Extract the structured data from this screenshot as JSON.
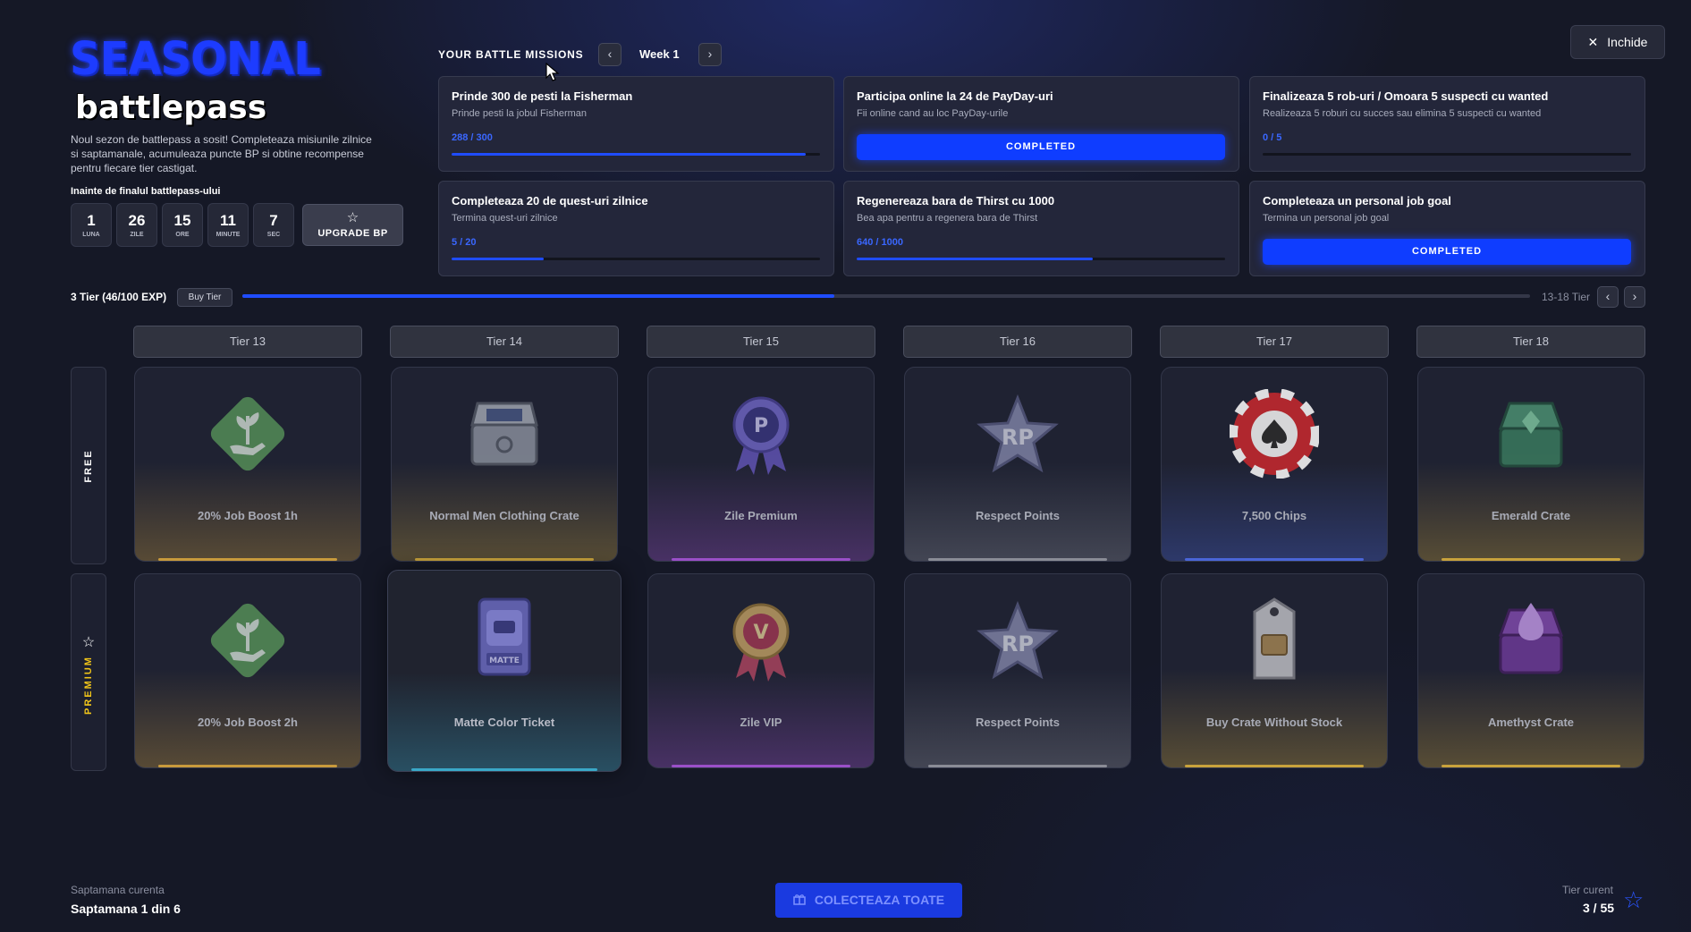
{
  "logo": {
    "seasonal": "SEASONAL",
    "battlepass": "battlepass"
  },
  "intro_text": "Noul sezon de battlepass a sosit! Completeaza misiunile zilnice si saptamanale, acumuleaza puncte BP si obtine recompense pentru fiecare tier castigat.",
  "countdown": {
    "title": "Inainte de finalul battlepass-ului",
    "units": [
      {
        "value": "1",
        "label": "LUNA"
      },
      {
        "value": "26",
        "label": "ZILE"
      },
      {
        "value": "15",
        "label": "ORE"
      },
      {
        "value": "11",
        "label": "MINUTE"
      },
      {
        "value": "7",
        "label": "SEC"
      }
    ]
  },
  "upgrade_button": {
    "label": "UPGRADE BP",
    "icon": "star-outline-icon"
  },
  "missions": {
    "title": "YOUR BATTLE MISSIONS",
    "prev_icon": "‹",
    "next_icon": "›",
    "week": "Week 1",
    "items": [
      {
        "title": "Prinde 300 de pesti la Fisherman",
        "desc": "Prinde pesti la jobul Fisherman",
        "progress_text": "288 / 300",
        "progress": 0.96,
        "completed": false
      },
      {
        "title": "Participa online la 24 de PayDay-uri",
        "desc": "Fii online cand au loc PayDay-urile",
        "progress_text": "",
        "progress": 1,
        "completed": true,
        "completed_label": "COMPLETED"
      },
      {
        "title": "Finalizeaza 5 rob-uri / Omoara 5 suspecti cu wanted",
        "desc": "Realizeaza 5 roburi cu succes sau elimina 5 suspecti cu wanted",
        "progress_text": "0 / 5",
        "progress": 0,
        "completed": false
      },
      {
        "title": "Completeaza 20 de quest-uri zilnice",
        "desc": "Termina quest-uri zilnice",
        "progress_text": "5 / 20",
        "progress": 0.25,
        "completed": false
      },
      {
        "title": "Regenereaza bara de Thirst cu 1000",
        "desc": "Bea apa pentru a regenera bara de Thirst",
        "progress_text": "640 / 1000",
        "progress": 0.64,
        "completed": false
      },
      {
        "title": "Completeaza un personal job goal",
        "desc": "Termina un personal job goal",
        "progress_text": "",
        "progress": 1,
        "completed": true,
        "completed_label": "COMPLETED"
      }
    ]
  },
  "close_button": {
    "label": "Inchide",
    "icon": "✕"
  },
  "tier_progress": {
    "status": "3 Tier (46/100 EXP)",
    "buy_label": "Buy Tier",
    "progress": 0.46,
    "range": "13-18 Tier",
    "prev_icon": "‹",
    "next_icon": "›"
  },
  "tiers": [
    "Tier 13",
    "Tier 14",
    "Tier 15",
    "Tier 16",
    "Tier 17",
    "Tier 18"
  ],
  "rows": {
    "free_label": "FREE",
    "premium_label": "PREMIUM",
    "premium_icon": "☆"
  },
  "rewards": {
    "free": [
      {
        "name": "20% Job Boost 1h",
        "icon": "plant-hand-icon",
        "color": "#c89a3c"
      },
      {
        "name": "Normal Men Clothing Crate",
        "icon": "clothing-crate-icon",
        "color": "#c8a23c"
      },
      {
        "name": "Zile Premium",
        "icon": "premium-ribbon-icon",
        "color": "#9a4fc8"
      },
      {
        "name": "Respect Points",
        "icon": "rp-star-icon",
        "color": "#8a8c96"
      },
      {
        "name": "7,500 Chips",
        "icon": "poker-chip-icon",
        "color": "#4a66d8"
      },
      {
        "name": "Emerald Crate",
        "icon": "emerald-crate-icon",
        "color": "#c8a23c"
      }
    ],
    "premium": [
      {
        "name": "20% Job Boost 2h",
        "icon": "plant-hand-icon",
        "color": "#c89a3c"
      },
      {
        "name": "Matte Color Ticket",
        "icon": "matte-ticket-icon",
        "color": "#3aa8c8"
      },
      {
        "name": "Zile VIP",
        "icon": "vip-ribbon-icon",
        "color": "#9a4fc8"
      },
      {
        "name": "Respect Points",
        "icon": "rp-star-icon",
        "color": "#8a8c96"
      },
      {
        "name": "Buy Crate Without Stock",
        "icon": "tag-crate-icon",
        "color": "#c8a23c"
      },
      {
        "name": "Amethyst Crate",
        "icon": "amethyst-crate-icon",
        "color": "#c8a23c"
      }
    ]
  },
  "bottom": {
    "week_label": "Saptamana curenta",
    "week_value": "Saptamana 1 din 6",
    "collect_label": "COLECTEAZA TOATE",
    "collect_icon": "gift-icon",
    "tier_label": "Tier curent",
    "tier_value": "3 / 55",
    "tier_icon": "☆"
  },
  "colors": {
    "accent": "#1f4cff",
    "background": "#151826",
    "card": "#23263a"
  }
}
